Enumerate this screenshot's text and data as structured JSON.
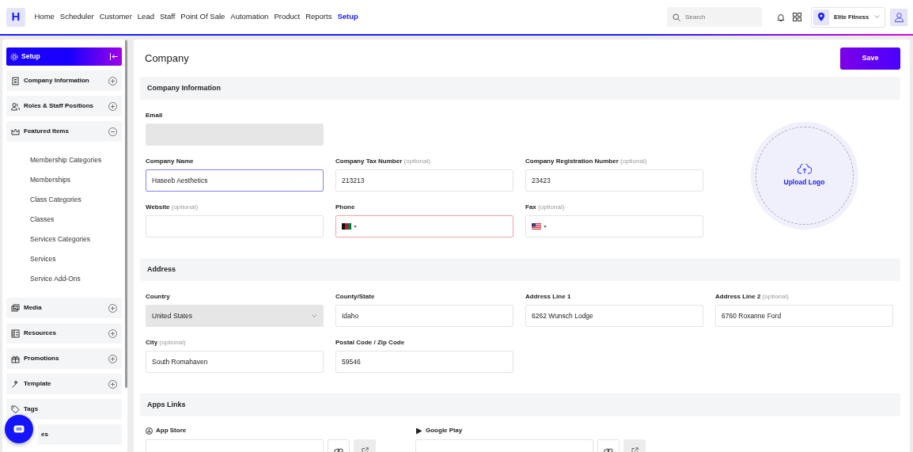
{
  "logo": "H",
  "nav": [
    {
      "label": "Home",
      "selected": false
    },
    {
      "label": "Scheduler",
      "selected": false
    },
    {
      "label": "Customer",
      "selected": false
    },
    {
      "label": "Lead",
      "selected": false
    },
    {
      "label": "Staff",
      "selected": false
    },
    {
      "label": "Point Of Sale",
      "selected": false
    },
    {
      "label": "Automation",
      "selected": false
    },
    {
      "label": "Product",
      "selected": false
    },
    {
      "label": "Reports",
      "selected": false
    },
    {
      "label": "Setup",
      "selected": true
    }
  ],
  "search": {
    "placeholder": "Search"
  },
  "location": "Elite Fitness",
  "sidebar": {
    "title": "Setup",
    "groups": [
      {
        "label": "Company Information",
        "expanded": false
      },
      {
        "label": "Roles & Staff Positions",
        "expanded": false
      },
      {
        "label": "Featured Items",
        "expanded": true,
        "children": [
          "Membership Categories",
          "Memberships",
          "Class Categories",
          "Classes",
          "Services Categories",
          "Services",
          "Service Add-Ons"
        ]
      },
      {
        "label": "Media",
        "expanded": false
      },
      {
        "label": "Resources",
        "expanded": false
      },
      {
        "label": "Promotions",
        "expanded": false
      },
      {
        "label": "Template",
        "expanded": false
      },
      {
        "label": "Tags"
      },
      {
        "label": "es"
      }
    ]
  },
  "page": {
    "title": "Company",
    "save": "Save"
  },
  "sections": [
    {
      "title": "Company Information",
      "upload": "Upload Logo",
      "rows": [
        [
          {
            "label": "Email",
            "kind": "disabled"
          }
        ],
        [
          {
            "label": "Company Name",
            "kind": "text",
            "value": "Haseeb Aesthetics",
            "focused": true
          },
          {
            "label": "Company Tax Number",
            "hint": "(optional)",
            "kind": "text",
            "value": "213213"
          },
          {
            "label": "Company Registration Number",
            "hint": "(optional)",
            "kind": "text",
            "value": "23423"
          }
        ],
        [
          {
            "label": "Website",
            "hint": "(optional)",
            "kind": "text"
          },
          {
            "label": "Phone",
            "kind": "phone",
            "invalid": true
          },
          {
            "label": "Fax",
            "hint": "(optional)",
            "kind": "phone"
          }
        ]
      ]
    },
    {
      "title": "Address",
      "rows": [
        [
          {
            "label": "Country",
            "kind": "select",
            "value": "United States"
          },
          {
            "label": "County/State",
            "kind": "text",
            "value": "Idaho"
          },
          {
            "label": "Address Line 1",
            "kind": "text",
            "value": "6262 Wunsch Lodge"
          },
          {
            "label": "Address Line 2",
            "hint": "(optional)",
            "kind": "text",
            "value": "6760 Roxanne Ford"
          }
        ],
        [
          {
            "label": "City",
            "hint": "(optional)",
            "kind": "text",
            "value": "South Romahaven"
          },
          {
            "label": "Postal Code / Zip Code",
            "kind": "text",
            "value": "59546"
          }
        ]
      ]
    },
    {
      "title": "Apps Links",
      "links": [
        {
          "label": "App Store"
        },
        {
          "label": "Google Play"
        }
      ]
    }
  ]
}
